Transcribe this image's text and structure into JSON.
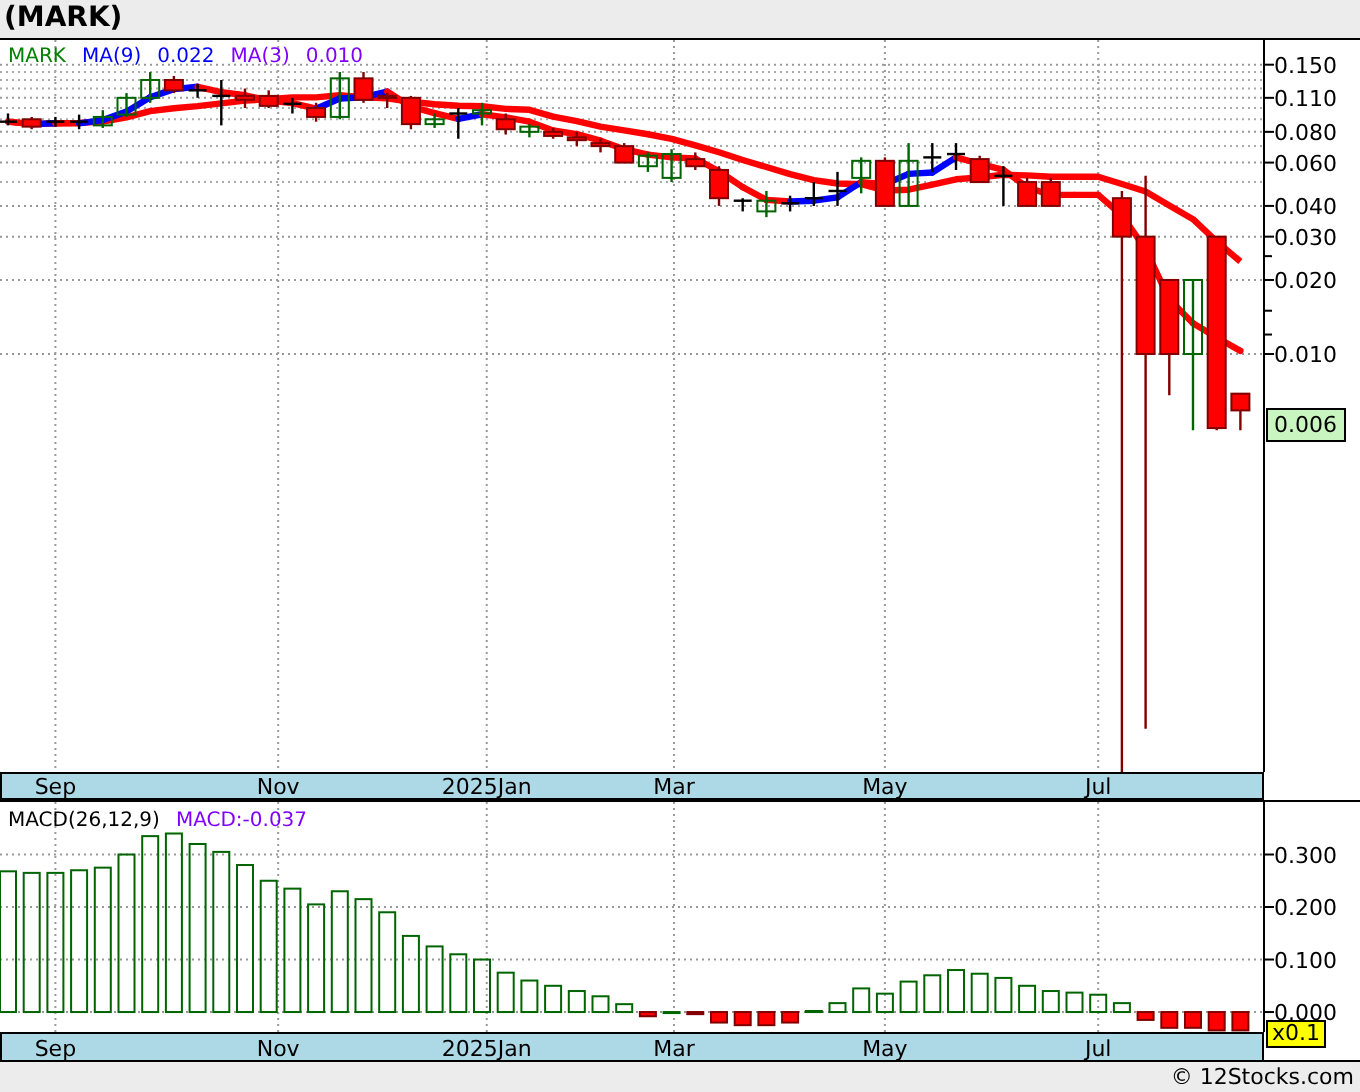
{
  "title": "(MARK)",
  "price_chart": {
    "legend": [
      {
        "text": "MARK",
        "color": "#008000"
      },
      {
        "text": "MA(9)",
        "color": "#0000ff"
      },
      {
        "text": "0.022",
        "color": "#0000ff"
      },
      {
        "text": "MA(3)",
        "color": "#8000ff"
      },
      {
        "text": "0.010",
        "color": "#8000ff"
      }
    ],
    "price_tag": "0.006",
    "axis_labels": [
      "0.150",
      "0.110",
      "0.080",
      "0.060",
      "0.040",
      "0.030",
      "0.020",
      "0.010"
    ],
    "date_labels": [
      "Sep",
      "Nov",
      "2025Jan",
      "Mar",
      "May",
      "Jul"
    ]
  },
  "macd_chart": {
    "legend": [
      {
        "text": "MACD(26,12,9)",
        "color": "#000000"
      },
      {
        "text": "MACD:-0.037",
        "color": "#8000ff"
      }
    ],
    "scale_badge": "x0.1",
    "date_labels": [
      "Sep",
      "Nov",
      "2025Jan",
      "Mar",
      "May",
      "Jul"
    ],
    "chart_data": {
      "type": "bar",
      "grid": true,
      "ylim": [
        -0.038,
        0.4
      ],
      "yticks": [
        {
          "value": 0.3,
          "label": "0.300"
        },
        {
          "value": 0.2,
          "label": "0.200"
        },
        {
          "value": 0.1,
          "label": "0.100"
        },
        {
          "value": 0,
          "label": "0.000"
        }
      ],
      "values": [
        0.268,
        0.265,
        0.265,
        0.27,
        0.275,
        0.3,
        0.335,
        0.34,
        0.32,
        0.305,
        0.28,
        0.25,
        0.235,
        0.205,
        0.23,
        0.215,
        0.19,
        0.145,
        0.125,
        0.11,
        0.1,
        0.075,
        0.06,
        0.05,
        0.04,
        0.03,
        0.015,
        -0.008,
        0,
        -0.004,
        -0.02,
        -0.025,
        -0.025,
        -0.02,
        0.002,
        0.017,
        0.045,
        0.035,
        0.058,
        0.07,
        0.08,
        0.073,
        0.065,
        0.05,
        0.04,
        0.037,
        0.033,
        0.017,
        -0.015,
        -0.03,
        -0.03,
        -0.035,
        -0.035
      ]
    }
  },
  "footer": "© 12Stocks.com"
}
